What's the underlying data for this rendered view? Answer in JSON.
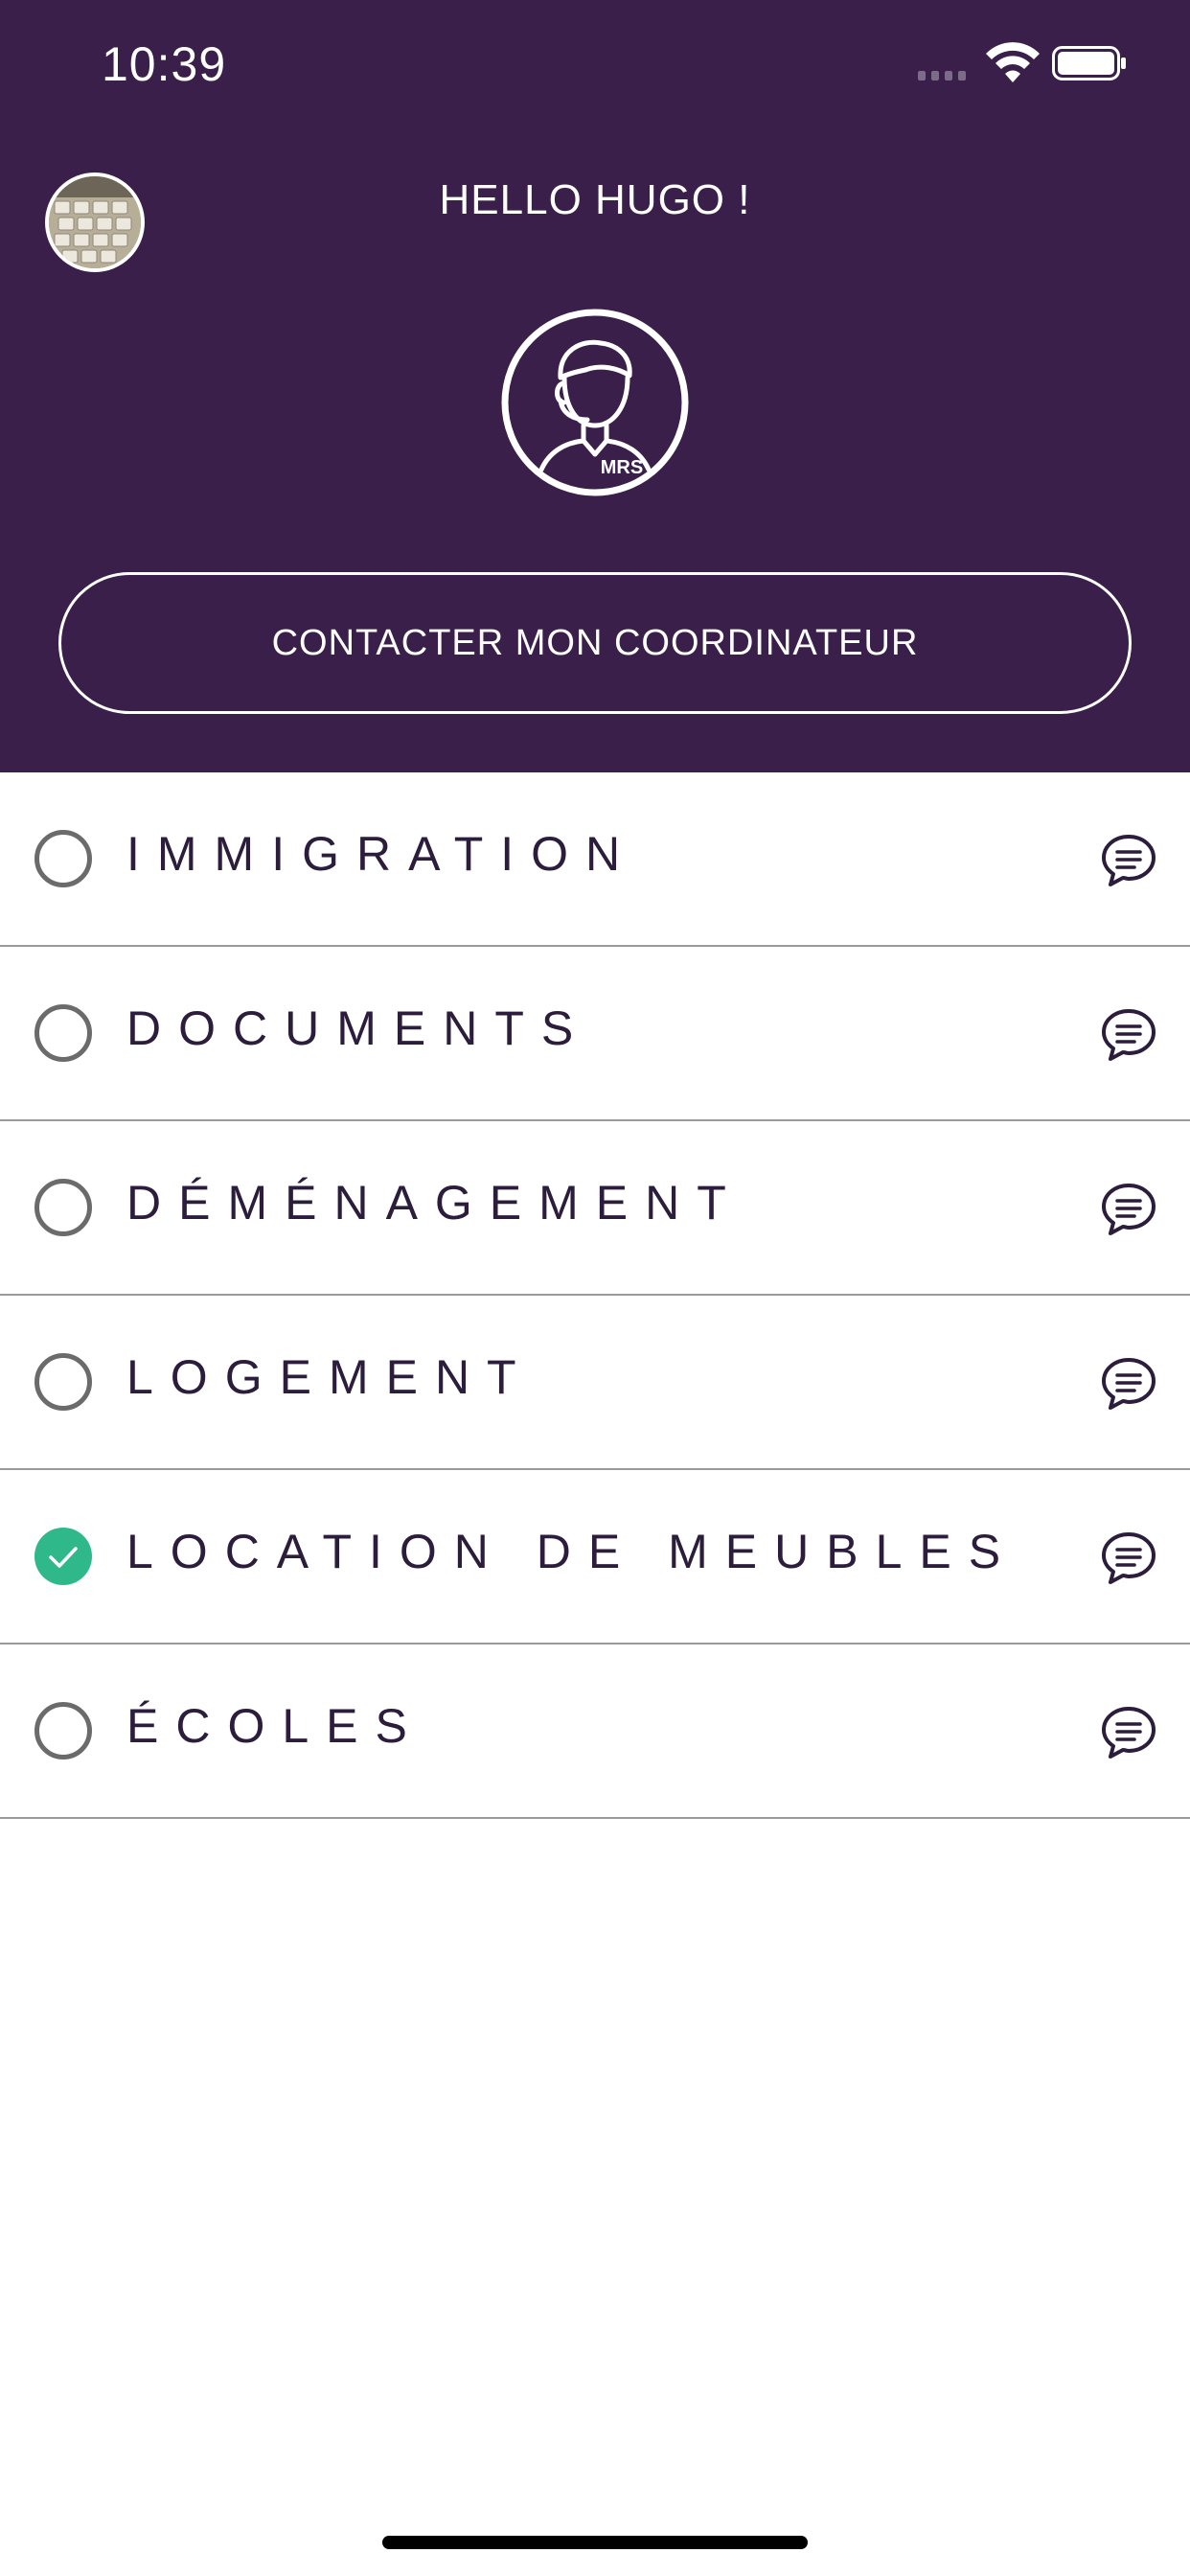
{
  "status_bar": {
    "time": "10:39"
  },
  "header": {
    "greeting": "HELLO HUGO !",
    "coordinator_badge": "MRS",
    "contact_button_label": "CONTACTER MON COORDINATEUR",
    "background_color": "#3a1f4b"
  },
  "categories": [
    {
      "label": "IMMIGRATION",
      "completed": false
    },
    {
      "label": "DOCUMENTS",
      "completed": false
    },
    {
      "label": "DÉMÉNAGEMENT",
      "completed": false
    },
    {
      "label": "LOGEMENT",
      "completed": false
    },
    {
      "label": "LOCATION DE MEUBLES",
      "completed": true
    },
    {
      "label": "ÉCOLES",
      "completed": false
    }
  ],
  "colors": {
    "completed": "#2fb88a",
    "label": "#2b1d3b"
  },
  "icons": {
    "avatar": "user-photo",
    "coordinator": "headset-agent-icon",
    "chat": "chat-bubble-icon",
    "status_incomplete": "empty-circle-icon",
    "status_complete": "check-circle-icon"
  }
}
